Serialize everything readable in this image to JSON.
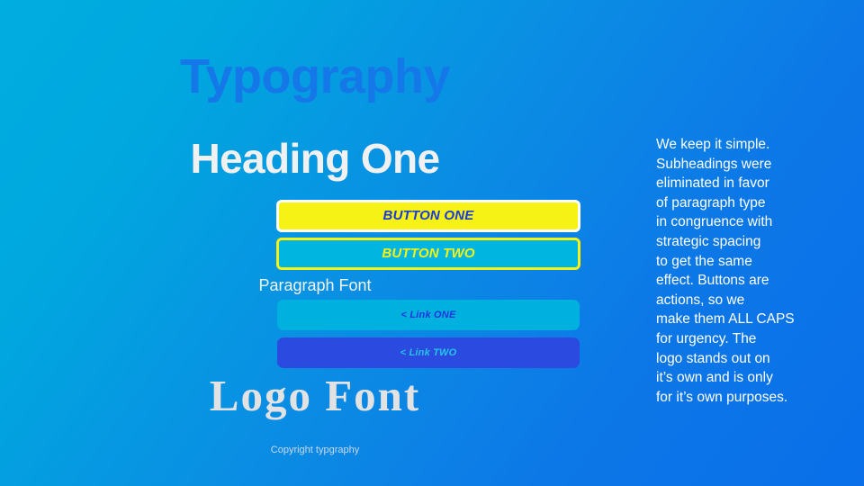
{
  "theme": {
    "bg_gradient_from": "#00ADE0",
    "bg_gradient_to": "#0A6FE9",
    "title_blue": "#1578E8",
    "accent_yellow": "#F7F215",
    "link_indigo": "#2B4BE0",
    "link_cyan": "#00B0DE",
    "text_white": "#FFFFFF"
  },
  "page": {
    "site_title": "Typography",
    "heading_one": "Heading One",
    "paragraph_font_label": "Paragraph Font",
    "logo_font": "Logo Font",
    "footer_copyright": "Copyright typgraphy"
  },
  "buttons": [
    {
      "label": "BUTTON ONE",
      "background": "#F7F215",
      "border_color": "#FFFFFF",
      "text_color": "#1A3BD8"
    },
    {
      "label": "BUTTON TWO",
      "background": "#00B5DF",
      "border_color": "#F7F215",
      "text_color": "#F7F215"
    }
  ],
  "links": [
    {
      "label": "< Link ONE",
      "background": "#00B0DE",
      "text_color": "#2233DD"
    },
    {
      "label": "< Link TWO",
      "background": "#2B4BE0",
      "text_color": "#22C4E8"
    }
  ],
  "body_copy": {
    "text": "We keep it simple.\nSubheadings were\neliminated in favor\nof paragraph type\nin congruence with\nstrategic spacing\nto get the same\neffect. Buttons are\nactions, so we\nmake them ALL CAPS\nfor urgency. The\nlogo stands out on\nit’s own and is only\nfor it’s own purposes."
  }
}
